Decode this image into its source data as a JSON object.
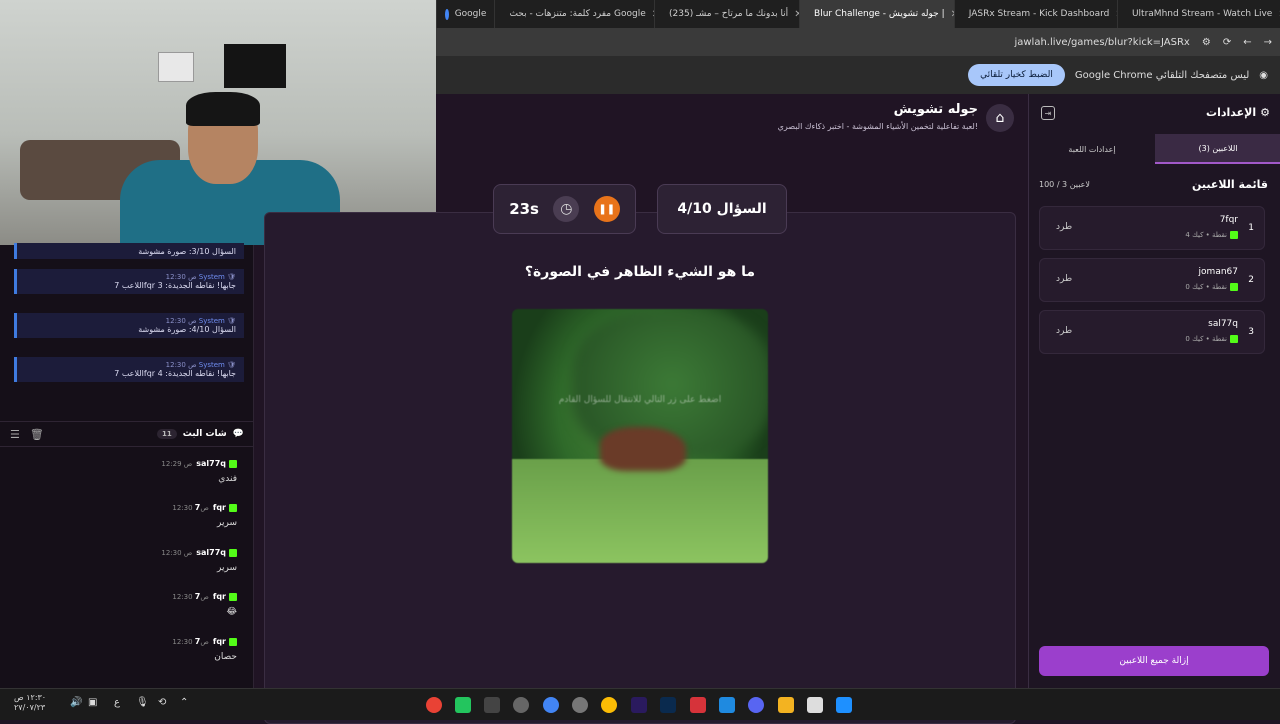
{
  "browser": {
    "tabs": [
      {
        "title": "UltraMhnd Stream - Watch Live",
        "color": "#53fc18"
      },
      {
        "title": "JASRx Stream - Kick Dashboard",
        "color": "#53fc18"
      },
      {
        "title": "Blur Challenge - جوله تشويش |",
        "color": "#aaaaaa",
        "active": true
      },
      {
        "title": "(235) أنا بدونك ما مرتاح – مشـ",
        "color": "#ff0000"
      },
      {
        "title": "مفرد كلمة: متنزهات - بحث Google",
        "color": "#4285f4"
      },
      {
        "title": "Google",
        "color": "#4285f4"
      }
    ],
    "url": "jawlah.live/games/blur?kick=JASRx",
    "infobar_text": "Google Chrome ليس متصفحك التلقائي",
    "infobar_button": "الضبط كخيار تلقائي"
  },
  "game": {
    "title": "جوله تشويش",
    "subtitle": "لعبة تفاعلية لتخمين الأشياء المشوشة - اختبر ذكاءك البصري!",
    "question_counter": "السؤال 4/10",
    "timer": "23s",
    "question": "ما هو الشيء الظاهر في الصورة؟",
    "image_hint": "اضغط على زر التالي للانتقال للسؤال القادم"
  },
  "settings": {
    "title": "الإعدادات",
    "tab_players": "اللاعبين (3)",
    "tab_game": "إعدادات اللعبة",
    "list_title": "قائمة اللاعبين",
    "count": "100 / 3 لاعبين",
    "players": [
      {
        "rank": "1",
        "name": "7fqr",
        "stats": "4 نقطة • كيك",
        "action": "طرد"
      },
      {
        "rank": "2",
        "name": "joman67",
        "stats": "0 نقطة • كيك",
        "action": "طرد"
      },
      {
        "rank": "3",
        "name": "sal77q",
        "stats": "0 نقطة • كيك",
        "action": "طرد"
      }
    ],
    "remove_all": "إزالة جميع اللاعبين"
  },
  "system_messages": [
    {
      "text": "السؤال 3/10: صورة مشوشة",
      "author": "",
      "time": ""
    },
    {
      "text": "اللاعب 7fqr جابها! نقاطه الجديدة: 3",
      "author": "System",
      "time": "12:30 ص"
    },
    {
      "text": "السؤال 4/10: صورة مشوشة",
      "author": "System",
      "time": "12:30 ص"
    },
    {
      "text": "اللاعب 7fqr جابها! نقاطه الجديدة: 4",
      "author": "System",
      "time": "12:30 ص"
    }
  ],
  "chat": {
    "title": "شات البث",
    "count": "11",
    "messages": [
      {
        "user": "sal77q",
        "time": "12:29 ص",
        "text": "فندي"
      },
      {
        "user": "7fqr",
        "time": "12:30 ص",
        "text": "سرير"
      },
      {
        "user": "sal77q",
        "time": "12:30 ص",
        "text": "سرير"
      },
      {
        "user": "7fqr",
        "time": "12:30 ص",
        "text": "😂"
      },
      {
        "user": "7fqr",
        "time": "12:30 ص",
        "text": "حصان"
      }
    ]
  },
  "taskbar": {
    "clock_time": "١٢:٣٠ ص",
    "clock_date": "٢٧/٠٧/٢٣",
    "lang": "ع"
  },
  "colors": {
    "accent": "#9b3fcc",
    "kick": "#53fc18",
    "timer_pause": "#e8731a"
  }
}
